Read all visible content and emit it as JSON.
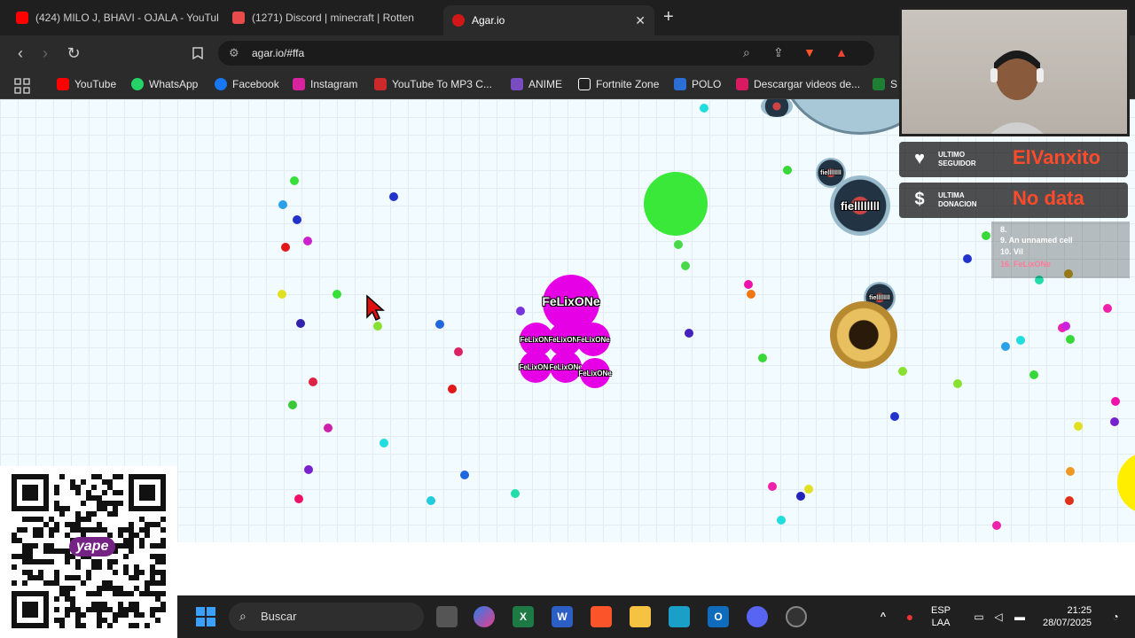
{
  "tabs": [
    {
      "label": "(424) MILO J, BHAVI - OJALA - YouTube",
      "favicon_color": "#ff0000"
    },
    {
      "label": "(1271) Discord | minecraft | Rotten",
      "favicon_color": "#e94b4b"
    },
    {
      "label": "Agar.io",
      "favicon_color": "#d01818",
      "close": "✕"
    }
  ],
  "new_tab": "+",
  "address": {
    "url": "agar.io/#ffa"
  },
  "bookmarks": [
    {
      "label": "YouTube",
      "color": "#ff0000"
    },
    {
      "label": "WhatsApp",
      "color": "#25d366"
    },
    {
      "label": "Facebook",
      "color": "#1877f2"
    },
    {
      "label": "Instagram",
      "color": "#d6249f"
    },
    {
      "label": "YouTube To MP3 C...",
      "color": "#cc2a2a"
    },
    {
      "label": "ANIME",
      "color": "#7a4cc2"
    },
    {
      "label": "Fortnite Zone",
      "color": "#222222"
    },
    {
      "label": "POLO",
      "color": "#2b6fd6"
    },
    {
      "label": "Descargar videos de...",
      "color": "#d81b60"
    },
    {
      "label": "S",
      "color": "#1e7e34"
    }
  ],
  "game": {
    "player_name": "FeLixONe",
    "split_name": "FeLixONe",
    "enemy_name": "fiellllllll",
    "player_color": "#e600e6",
    "green_cell_color": "#3ae83a"
  },
  "stream_alerts": [
    {
      "caption": "ULTIMO SEGUIDOR",
      "value": "ElVanxito",
      "icon": "♥"
    },
    {
      "caption": "ULTIMA DONACION",
      "value": "No data",
      "icon": "$"
    }
  ],
  "leaderboard": [
    {
      "text": "8. "
    },
    {
      "text": "9. An unnamed cell"
    },
    {
      "text": "10. Vil"
    },
    {
      "text": "16. FeLixONe"
    }
  ],
  "qr_brand": "yape",
  "taskbar": {
    "search_label": "Buscar",
    "language": "ESP",
    "layout": "LAA",
    "time": "21:25",
    "date": "28/07/2025"
  }
}
